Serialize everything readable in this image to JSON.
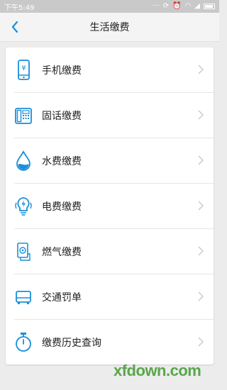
{
  "status": {
    "time": "下午5:49"
  },
  "nav": {
    "title": "生活缴费"
  },
  "items": [
    {
      "label": "手机缴费",
      "icon": "mobile-phone-icon"
    },
    {
      "label": "固话缴费",
      "icon": "landline-phone-icon"
    },
    {
      "label": "水费缴费",
      "icon": "water-drop-icon"
    },
    {
      "label": "电费缴费",
      "icon": "lightbulb-icon"
    },
    {
      "label": "燃气缴费",
      "icon": "gas-meter-icon"
    },
    {
      "label": "交通罚单",
      "icon": "car-icon"
    },
    {
      "label": "缴费历史查询",
      "icon": "stopwatch-icon"
    }
  ],
  "watermark": "xfdown.com",
  "colors": {
    "accent": "#1a8fd8",
    "chevron": "#c8c8c8",
    "watermark": "#5aa64a"
  }
}
